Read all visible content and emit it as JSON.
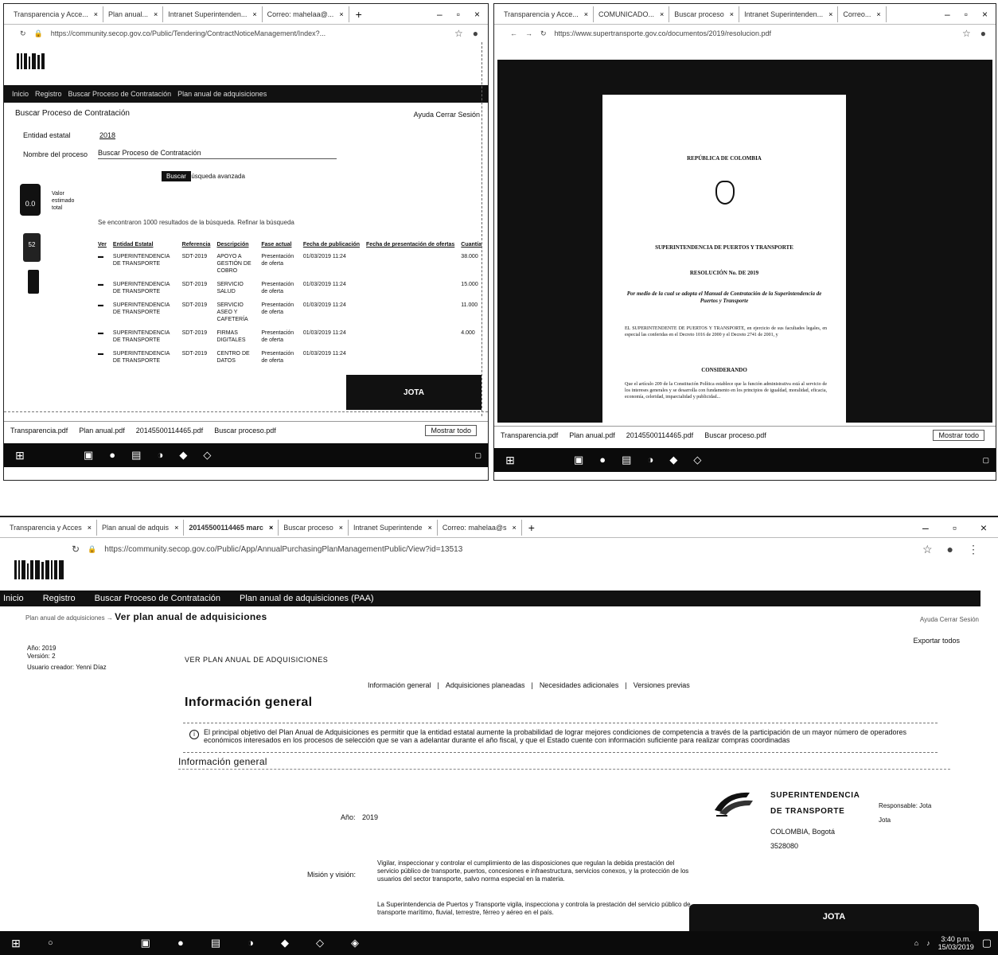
{
  "top_left": {
    "tabs": [
      "Transparencia y Acce...",
      "Plan anual...",
      "Intranet Superintenden...",
      "Correo: mahelaa@..."
    ],
    "url": "https://community.secop.gov.co/Public/Tendering/ContractNoticeManagement/Index?...",
    "nav": [
      "Inicio",
      "Registro",
      "Buscar Proceso de Contratación",
      "Plan anual de adquisiciones"
    ],
    "breadcrumb": "Buscar Proceso de Contratación",
    "help": "Ayuda   Cerrar Sesión",
    "label_entity": "Entidad estatal",
    "value_entity": "2018",
    "label_name": "Nombre del proceso",
    "value_name": "Buscar Proceso de Contratación",
    "btn_search": "Buscar",
    "btn_advanced": "Búsqueda avanzada",
    "result_info": "Se encontraron 1000 resultados de la búsqueda. Refinar la búsqueda",
    "side_widget_1": "0.0",
    "side_widget_2": "52",
    "side_text": "Valor estimado total",
    "table_headers": [
      "Ver",
      "Entidad Estatal",
      "Referencia",
      "Descripción",
      "Fase actual",
      "Fecha de publicación",
      "Fecha de presentación de ofertas",
      "Cuantía"
    ],
    "rows": [
      {
        "entity": "SUPERINTENDENCIA DE TRANSPORTE",
        "ref": "SDT-2019",
        "desc": "APOYO A GESTIÓN DE COBRO",
        "phase": "Presentación de oferta",
        "date": "01/03/2019 11:24",
        "amount": "38.000"
      },
      {
        "entity": "SUPERINTENDENCIA DE TRANSPORTE",
        "ref": "SDT-2019",
        "desc": "SERVICIO SALUD",
        "phase": "Presentación de oferta",
        "date": "01/03/2019 11:24",
        "amount": "15.000"
      },
      {
        "entity": "SUPERINTENDENCIA DE TRANSPORTE",
        "ref": "SDT-2019",
        "desc": "SERVICIO ASEO Y CAFETERÍA",
        "phase": "Presentación de oferta",
        "date": "01/03/2019 11:24",
        "amount": "11.000"
      },
      {
        "entity": "SUPERINTENDENCIA DE TRANSPORTE",
        "ref": "SDT-2019",
        "desc": "FIRMAS DIGITALES",
        "phase": "Presentación de oferta",
        "date": "01/03/2019 11:24",
        "amount": "4.000"
      },
      {
        "entity": "SUPERINTENDENCIA DE TRANSPORTE",
        "ref": "SDT-2019",
        "desc": "CENTRO DE DATOS",
        "phase": "Presentación de oferta",
        "date": "01/03/2019 11:24",
        "amount": ""
      }
    ],
    "toast": "JOTA",
    "downloads": [
      "Transparencia.pdf",
      "Plan anual.pdf",
      "20145500114465.pdf",
      "Buscar proceso.pdf"
    ],
    "show_all": "Mostrar todo"
  },
  "top_right": {
    "tabs": [
      "Transparencia y Acce...",
      "COMUNICADO...",
      "Buscar proceso",
      "Intranet Superintenden...",
      "Correo..."
    ],
    "url": "https://www.supertransporte.gov.co/documentos/2019/resolucion.pdf",
    "pdf": {
      "country": "REPÚBLICA DE COLOMBIA",
      "agency": "SUPERINTENDENCIA DE PUERTOS Y TRANSPORTE",
      "resolution": "RESOLUCIÓN No.     DE 2019",
      "subject": "Por medio de la cual se adopta el Manual de Contratación de la Superintendencia de Puertos y Transporte",
      "intro": "EL SUPERINTENDENTE DE PUERTOS Y TRANSPORTE, en ejercicio de sus facultades legales, en especial las conferidas en el Decreto 1016 de 2000 y el Decreto 2741 de 2001, y",
      "considerando": "CONSIDERANDO",
      "body": "Que el artículo 209 de la Constitución Política establece que la función administrativa está al servicio de los intereses generales y se desarrolla con fundamento en los principios de igualdad, moralidad, eficacia, economía, celeridad, imparcialidad y publicidad..."
    },
    "downloads": [
      "Transparencia.pdf",
      "Plan anual.pdf",
      "20145500114465.pdf",
      "Buscar proceso.pdf"
    ],
    "show_all": "Mostrar todo"
  },
  "bottom": {
    "tabs": [
      "Transparencia y Acces",
      "Plan anual de adquis",
      "20145500114465 marc",
      "Buscar proceso",
      "Intranet Superintende",
      "Correo: mahelaa@s"
    ],
    "url": "https://community.secop.gov.co/Public/App/AnnualPurchasingPlanManagementPublic/View?id=13513",
    "nav": [
      "Inicio",
      "Registro",
      "Buscar Proceso de Contratación",
      "Plan anual de adquisiciones (PAA)"
    ],
    "breadcrumb_prefix": "Plan anual de adquisiciones",
    "breadcrumb_title": "Ver plan anual de adquisiciones",
    "help": "Ayuda   Cerrar Sesión",
    "export": "Exportar todos",
    "meta_year": "Año: 2019",
    "meta_version": "Versión: 2",
    "meta_user": "Usuario creador: Yenni Díaz",
    "section_title": "VER PLAN ANUAL DE ADQUISICIONES",
    "subnav": [
      "Información general",
      "|",
      "Adquisiciones planeadas",
      "|",
      "Necesidades adicionales",
      "|",
      "Versiones previas"
    ],
    "info_heading": "Información general",
    "info_text": "El principal objetivo del Plan Anual de Adquisiciones es permitir que la entidad estatal aumente la probabilidad de lograr mejores condiciones de competencia a través de la participación de un mayor número de operadores económicos interesados en los procesos de selección que se van a adelantar durante el año fiscal, y que el Estado cuente con información suficiente para realizar compras coordinadas",
    "info_heading_2": "Información general",
    "org_name_1": "SUPERINTENDENCIA",
    "org_name_2": "DE TRANSPORTE",
    "org_side_1": "Responsable: Jota",
    "org_side_2": "Jota",
    "org_loc": "COLOMBIA, Bogotá",
    "org_phone": "3528080",
    "year_label": "Año:",
    "year_value": "2019",
    "mission_label": "Misión y visión:",
    "mission_text": "Vigilar, inspeccionar y controlar el cumplimiento de las disposiciones que regulan la debida prestación del servicio público de transporte, puertos, concesiones e infraestructura, servicios conexos, y la protección de los usuarios del sector transporte, salvo norma especial en la materia.",
    "mission_text_2": "La Superintendencia de Puertos y Transporte vigila, inspecciona y controla la prestación del servicio público de transporte marítimo, fluvial, terrestre, férreo y aéreo en el país.",
    "toast": "JOTA",
    "clock_time": "3:40 p.m.",
    "clock_date": "15/03/2019"
  }
}
